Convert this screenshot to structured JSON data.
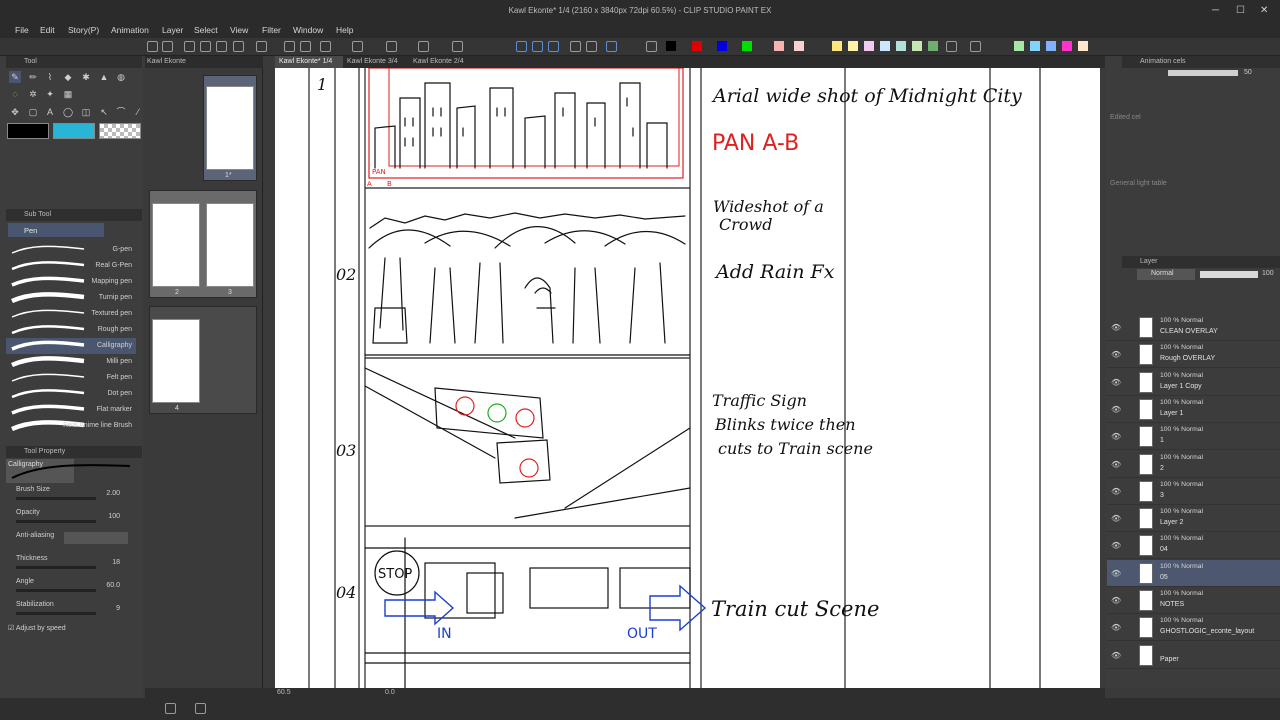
{
  "app": {
    "title": "Kawl Ekonte* 1/4 (2160 x 3840px 72dpi 60.5%) - CLIP STUDIO PAINT EX"
  },
  "menu": [
    "File",
    "Edit",
    "Story(P)",
    "Animation",
    "Layer",
    "Select",
    "View",
    "Filter",
    "Window",
    "Help"
  ],
  "colors": {
    "main_color": "#000000",
    "sub_color": "#29b6d6",
    "palette": [
      "#000000",
      "#ffffff",
      "#e00000",
      "#ffffff",
      "#0000e0",
      "#ffffff",
      "#00e000",
      "#ffffff",
      "#f5b3b3",
      "#f7d1d1",
      "#ffe680",
      "#fff2a6",
      "#f5f5b0",
      "#f0c8f0",
      "#cce6ff",
      "#b3e0d9",
      "#c6e6b3",
      "#6fae6f",
      "#ffffff",
      "#a6e6a6",
      "#b3ffb3",
      "#80d4ff",
      "#80b3ff",
      "#ff33cc",
      "#ffe6cc"
    ]
  },
  "left_panel": {
    "tool_tab": "Tool",
    "file_tab": "Kawl Ekonte",
    "subtool_tab": "Sub Tool",
    "subtool_group": "Pen",
    "subtools": [
      "G-pen",
      "Real G-Pen",
      "Mapping pen",
      "Turnip pen",
      "Textured pen",
      "Rough pen",
      "Calligraphy",
      "Milli pen",
      "Felt pen",
      "Dot pen",
      "Flat marker",
      "Real Anime line Brush"
    ],
    "selected_subtool": "Calligraphy",
    "tool_property_tab": "Tool Property",
    "tool_property_name": "Calligraphy",
    "properties": [
      {
        "label": "Brush Size",
        "value": "2.00"
      },
      {
        "label": "Opacity",
        "value": "100"
      },
      {
        "label": "Anti-aliasing",
        "value": ""
      },
      {
        "label": "Thickness",
        "value": "18"
      },
      {
        "label": "Angle",
        "value": "60.0"
      },
      {
        "label": "Stabilization",
        "value": "9"
      }
    ],
    "adjust_by_speed": "Adjust by speed"
  },
  "pages": {
    "thumbs": [
      {
        "label": "1*"
      },
      {
        "label": "2"
      },
      {
        "label": "3"
      },
      {
        "label": "4"
      }
    ]
  },
  "tabs": [
    "Kawl Ekonte* 1/4",
    "Kawl Ekonte 3/4",
    "Kawl Ekonte 2/4"
  ],
  "storyboard": {
    "cuts": [
      "1",
      "02",
      "03",
      "04"
    ],
    "notes": {
      "cut1_line": "Arial wide shot of Midnight City",
      "cut1_pan": "PAN A-B",
      "pan_label": "PAN",
      "pan_a": "A",
      "pan_b": "B",
      "cut2_line1": "Wideshot of a",
      "cut2_line2": "Crowd",
      "cut2_line3": "Add Rain Fx",
      "cut3_line1": "Traffic Sign",
      "cut3_line2": "Blinks twice then",
      "cut3_line3": "cuts to Train scene",
      "cut4_line": "Train cut Scene",
      "stop": "STOP",
      "in": "IN",
      "out": "OUT"
    }
  },
  "status": {
    "zoom": "60.5",
    "angle": "0.0"
  },
  "right_panel": {
    "animation_cels_tab": "Animation cels",
    "cel_value": "50",
    "edited_cel": "Edited cel",
    "light_table": "General light table",
    "layer_tab": "Layer",
    "blend_mode": "Normal",
    "opacity": "100",
    "layers": [
      {
        "mode": "100 % Normal",
        "name": "CLEAN OVERLAY"
      },
      {
        "mode": "100 % Normal",
        "name": "Rough OVERLAY"
      },
      {
        "mode": "100 % Normal",
        "name": "Layer 1 Copy"
      },
      {
        "mode": "100 % Normal",
        "name": "Layer 1"
      },
      {
        "mode": "100 % Normal",
        "name": "1"
      },
      {
        "mode": "100 % Normal",
        "name": "2"
      },
      {
        "mode": "100 % Normal",
        "name": "3"
      },
      {
        "mode": "100 % Normal",
        "name": "Layer 2"
      },
      {
        "mode": "100 % Normal",
        "name": "04"
      },
      {
        "mode": "100 % Normal",
        "name": "05"
      },
      {
        "mode": "100 % Normal",
        "name": "NOTES"
      },
      {
        "mode": "100 % Normal",
        "name": "GHOSTLOGIC_econte_layout"
      },
      {
        "mode": "",
        "name": "Paper"
      }
    ],
    "selected_layer": "05"
  }
}
